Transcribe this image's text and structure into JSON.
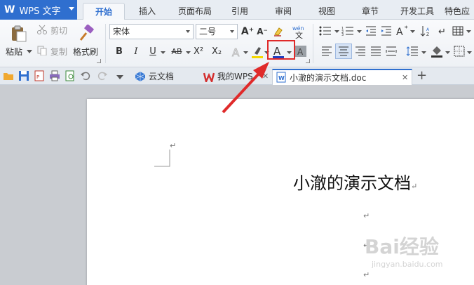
{
  "app": {
    "name": "WPS 文字",
    "logo": "W"
  },
  "menu": {
    "tabs": [
      {
        "label": "开始",
        "active": true
      },
      {
        "label": "插入"
      },
      {
        "label": "页面布局"
      },
      {
        "label": "引用"
      },
      {
        "label": "审阅"
      },
      {
        "label": "视图"
      },
      {
        "label": "章节"
      },
      {
        "label": "开发工具"
      },
      {
        "label": "特色应"
      }
    ]
  },
  "ribbon": {
    "paste_label": "粘贴",
    "cut_label": "剪切",
    "copy_label": "复制",
    "format_painter_label": "格式刷",
    "font_name": "宋体",
    "font_size": "二号",
    "grow_font": "A⁺",
    "shrink_font": "A⁻",
    "bold": "B",
    "italic": "I",
    "underline": "U",
    "strikethrough": "AB",
    "superscript": "X²",
    "subscript": "X₂",
    "font_color_letter": "A",
    "font_color": "#1f3fbf",
    "highlight_color": "#f5d800",
    "accent": "#2f6fcf"
  },
  "quickbar": {
    "tabs": [
      {
        "label": "云文档",
        "icon": "cloud-doc-icon"
      },
      {
        "label": "我的WPS",
        "icon": "wps-logo-icon"
      },
      {
        "label": "小澈的演示文档.doc",
        "icon": "doc-file-icon",
        "active": true
      }
    ],
    "add_tab": "+"
  },
  "document": {
    "title": "小澈的演示文档",
    "paragraph_mark": "↵"
  },
  "watermark": {
    "text": "Bai经验",
    "sub": "jingyan.baidu.com"
  },
  "annotation": {
    "color": "#e02a2a"
  }
}
